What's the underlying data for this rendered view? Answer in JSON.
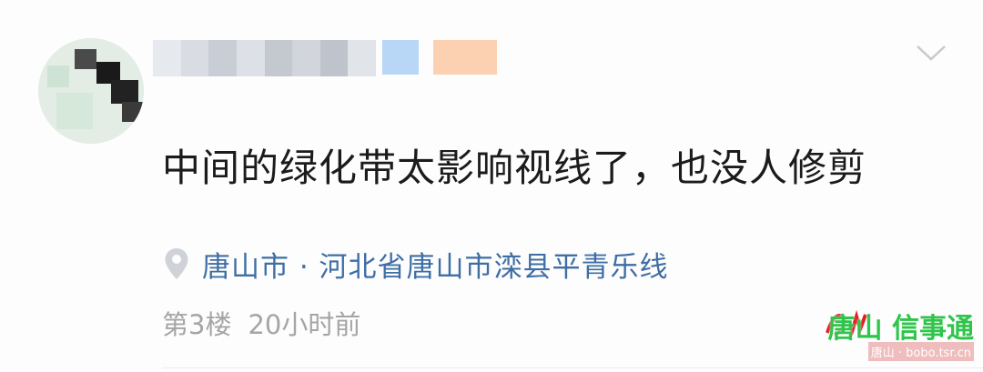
{
  "post": {
    "content": "中间的绿化带太影响视线了，也没人修剪",
    "location": "唐山市 · 河北省唐山市滦县平青乐线",
    "floor": "第3楼",
    "time": "20小时前"
  },
  "watermark": {
    "main": "唐山 信事通",
    "sub": "唐山 · bobo.tsr.cn"
  },
  "icons": {
    "menu": "chevron-down-icon",
    "location": "location-pin-icon"
  },
  "colors": {
    "location_text": "#3f6ea5",
    "meta_text": "#a5a5a5",
    "content_text": "#1b1b1b",
    "watermark_green": "#2ec54a"
  }
}
